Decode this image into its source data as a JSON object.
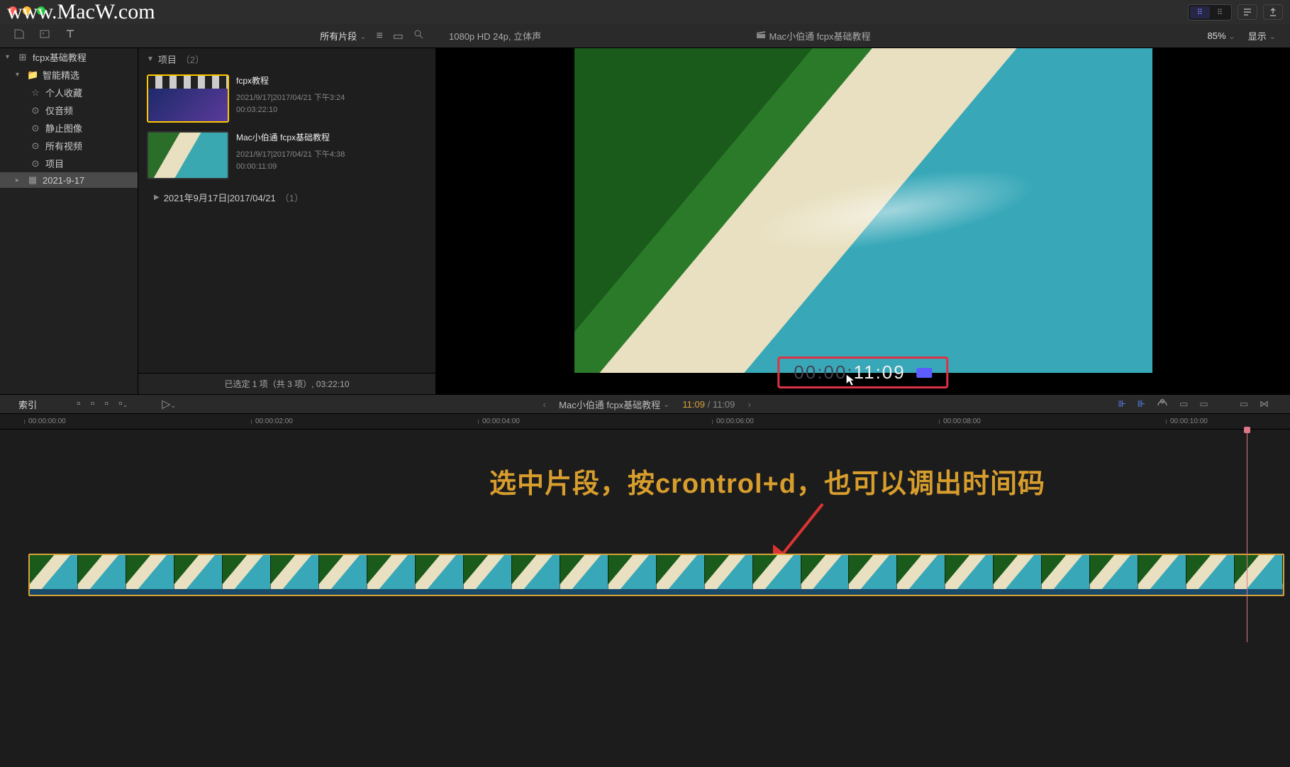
{
  "watermark": "www.MacW.com",
  "titlebar": {
    "seg1": "⠿",
    "seg2": "⠿"
  },
  "toolbar": {
    "dropdown": "所有片段",
    "viewer_format": "1080p HD 24p, 立体声",
    "viewer_title": "Mac小伯通 fcpx基础教程",
    "zoom": "85%",
    "display": "显示"
  },
  "sidebar": {
    "items": [
      {
        "label": "fcpx基础教程",
        "icon": "⊞",
        "disc": "▾"
      },
      {
        "label": "智能精选",
        "icon": "📁",
        "disc": "▾"
      },
      {
        "label": "个人收藏",
        "icon": "☆"
      },
      {
        "label": "仅音频",
        "icon": "⊙"
      },
      {
        "label": "静止图像",
        "icon": "⊙"
      },
      {
        "label": "所有视频",
        "icon": "⊙"
      },
      {
        "label": "项目",
        "icon": "⊙"
      },
      {
        "label": "2021-9-17",
        "icon": "▦",
        "disc": "▸",
        "selected": true
      }
    ]
  },
  "browser": {
    "header": "项目",
    "header_count": "（2）",
    "clips": [
      {
        "title": "fcpx教程",
        "meta1": "2021/9/17|2017/04/21 下午3:24",
        "meta2": "00:03:22:10",
        "selected": true,
        "kind": "slate"
      },
      {
        "title": "Mac小伯通 fcpx基础教程",
        "meta1": "2021/9/17|2017/04/21 下午4:38",
        "meta2": "00:00:11:09",
        "kind": "beach"
      }
    ],
    "date_group": "2021年9月17日|2017/04/21",
    "date_count": "（1）",
    "footer": "已选定 1 项（共 3 项）, 03:22:10"
  },
  "timecode": {
    "gray": "00:00:",
    "white": "11:09"
  },
  "midbar": {
    "index": "索引",
    "project": "Mac小伯通 fcpx基础教程",
    "tc_current": "11:09",
    "tc_total": "11:09"
  },
  "ruler": {
    "ticks": [
      "00:00:00:00",
      "00:00:02:00",
      "00:00:04:00",
      "00:00:06:00",
      "00:00:08:00",
      "00:00:10:00"
    ],
    "positions": [
      40,
      360,
      680,
      1010,
      1330,
      1650
    ]
  },
  "clip_track": {
    "label": "4f5d079a3bd8e1a6f6b8733bec7eee74"
  },
  "annotation": "选中片段，按crontrol+d，也可以调出时间码"
}
